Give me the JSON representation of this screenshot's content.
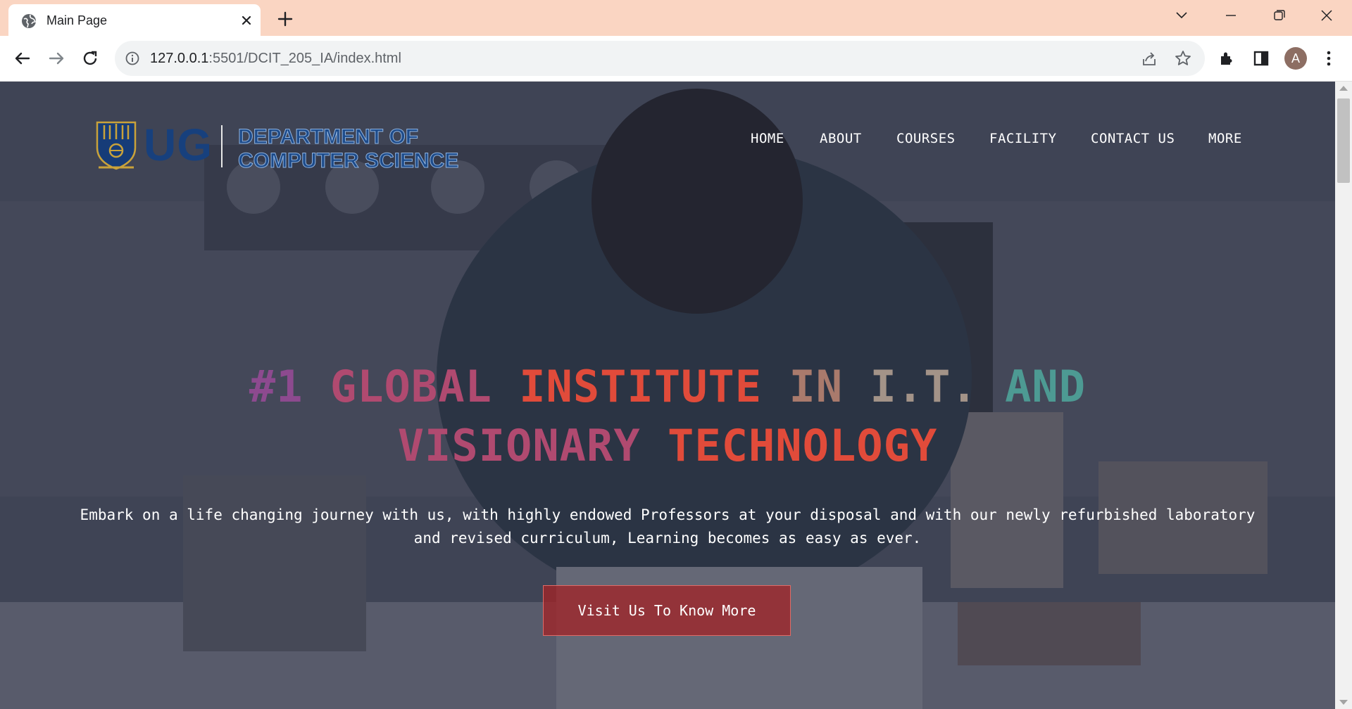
{
  "browser": {
    "tab_title": "Main Page",
    "url_host": "127.0.0.1",
    "url_path": ":5501/DCIT_205_IA/index.html",
    "profile_initial": "A"
  },
  "site": {
    "logo_ug": "UG",
    "logo_dept_line1": "DEPARTMENT OF",
    "logo_dept_line2": "COMPUTER SCIENCE",
    "nav": [
      {
        "label": "HOME"
      },
      {
        "label": "ABOUT"
      },
      {
        "label": "COURSES"
      },
      {
        "label": "FACILITY"
      },
      {
        "label": "CONTACT US"
      },
      {
        "label": "MORE"
      }
    ],
    "headline": {
      "w1": "#1",
      "w2": "GLOBAL",
      "w3": "INSTITUTE",
      "w4": "IN",
      "w5": "I.T.",
      "w6": "AND",
      "w7": "VISIONARY",
      "w8": "TECHNOLOGY"
    },
    "tagline": "Embark on a life changing journey with us, with highly endowed Professors at your disposal and with our newly refurbished laboratory and revised curriculum, Learning becomes as easy as ever.",
    "cta_label": "Visit Us To Know More"
  },
  "colors": {
    "tabstrip": "#fad5c2",
    "headline_purple": "#8d4a8f",
    "headline_red": "#e14b3a",
    "headline_teal": "#4d9a93",
    "cta_background": "#a02428"
  },
  "icons": [
    "globe-icon",
    "close-icon",
    "plus-icon",
    "chevron-down-icon",
    "minimize-icon",
    "restore-icon",
    "window-close-icon",
    "back-arrow-icon",
    "forward-arrow-icon",
    "reload-icon",
    "info-icon",
    "share-icon",
    "star-icon",
    "extensions-icon",
    "side-panel-icon",
    "kebab-menu-icon",
    "crest-icon"
  ]
}
